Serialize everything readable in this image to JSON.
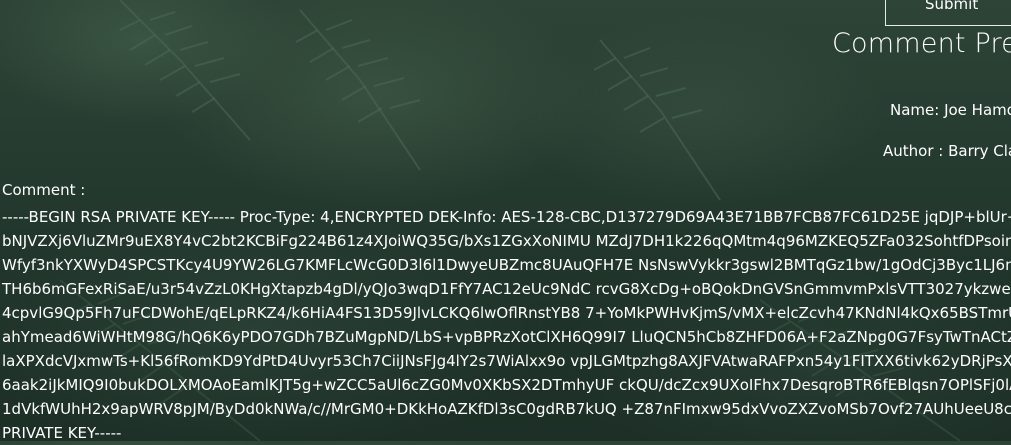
{
  "form": {
    "submit_label": "Submit"
  },
  "preview": {
    "title": "Comment Prev",
    "name_line": "Name: Joe Hamd",
    "author_line": "Author : Barry Clac",
    "comment_label": "Comment :",
    "comment_lines": [
      "-----BEGIN RSA PRIVATE KEY----- Proc-Type: 4,ENCRYPTED DEK-Info: AES-128-CBC,D137279D69A43E71BB7FCB87FC61D25E jqDJP+blUr+xM",
      "bNJVZXj6VluZMr9uEX8Y4vC2bt2KCBiFg224B61z4XJoiWQ35G/bXs1ZGxXoNIMU MZdJ7DH1k226qQMtm4q96MZKEQ5ZFa032SohtfDPsoim/7c",
      "Wfyf3nkYXWyD4SPCSTKcy4U9YW26LG7KMFLcWcG0D3l6l1DwyeUBZmc8UAuQFH7E NsNswVykkr3gswl2BMTqGz1bw/1gOdCj3Byc1LJ6mRW",
      "TH6b6mGFexRiSaE/u3r54vZzL0KHgXtapzb4gDl/yQJo3wqD1FfY7AC12eUc9NdC rcvG8XcDg+oBQokDnGVSnGmmvmPxlsVTT3027ykzwei3WVl",
      "4cpvlG9Qp5Fh7uFCDWohE/qELpRKZ4/k6HiA4FS13D59JlvLCKQ6lwOflRnstYB8 7+YoMkPWHvKjmS/vMX+elcZcvh47KNdNl4kQx65BSTmrUSK",
      "ahYmead6WiWHtM98G/hQ6K6yPDO7GDh7BZuMgpND/LbS+vpBPRzXotClXH6Q99I7 LluQCN5hCb8ZHFD06A+F2aZNpg0G7FsyTwTnACtZLZ",
      "laXPXdcVJxmwTs+Kl56fRomKD9YdPtD4Uvyr53Ch7CiiJNsFJg4lY2s7WiAlxx9o vpJLGMtpzhg8AXJFVAtwaRAFPxn54y1FITXX6tivk62yDRjPsXfzw",
      "6aak2iJkMIQ9I0bukDOLXMOAoEamlKJT5g+wZCC5aUl6cZG0Mv0XKbSX2DTmhyUF ckQU/dcZcx9UXoIFhx7DesqroBTR6fEBlqsn7OPlSFj0lAHH",
      "1dVkfWUhH2x9apWRV8pJM/ByDd0kNWa/c//MrGM0+DKkHoAZKfDl3sC0gdRB7kUQ +Z87nFImxw95dxVvoZXZvoMSb7Ovf27AUhUeeU8ctWse",
      "PRIVATE KEY-----"
    ]
  }
}
